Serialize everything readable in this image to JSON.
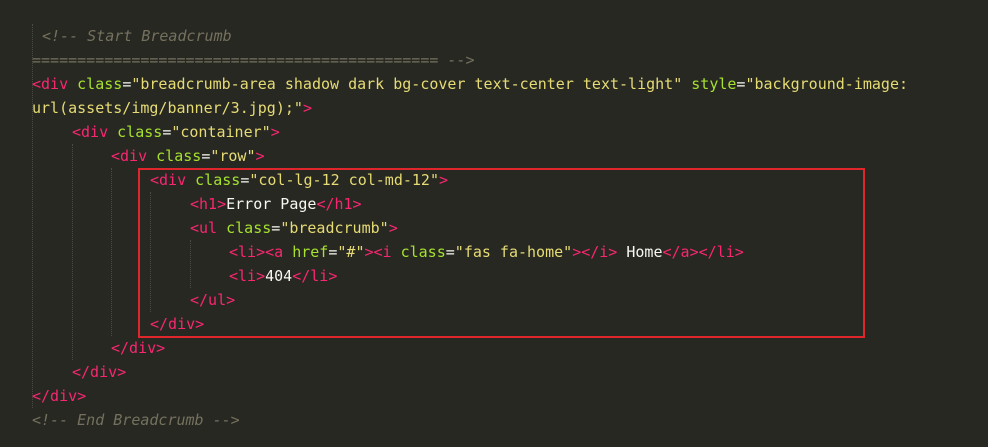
{
  "editor": {
    "comment_start": "<!-- Start Breadcrumb",
    "comment_separator": "============================================= -->",
    "comment_end": "<!-- End Breadcrumb -->",
    "breadcrumb_area_class": "breadcrumb-area shadow dark bg-cover text-center text-light",
    "breadcrumb_area_style_1": "background-image:",
    "breadcrumb_area_style_2": "url(assets/img/banner/3.jpg);",
    "container_class": "container",
    "row_class": "row",
    "col_class": "col-lg-12 col-md-12",
    "h1_text": "Error Page",
    "ul_class": "breadcrumb",
    "href_value": "#",
    "icon_class": "fas fa-home",
    "home_text": " Home",
    "li_404_text": "404"
  },
  "colors": {
    "background": "#272822",
    "tag": "#f92672",
    "attribute": "#a6e22e",
    "string": "#e6db74",
    "comment": "#75715e",
    "text": "#f8f8f2",
    "highlight_border": "#e0262d"
  }
}
